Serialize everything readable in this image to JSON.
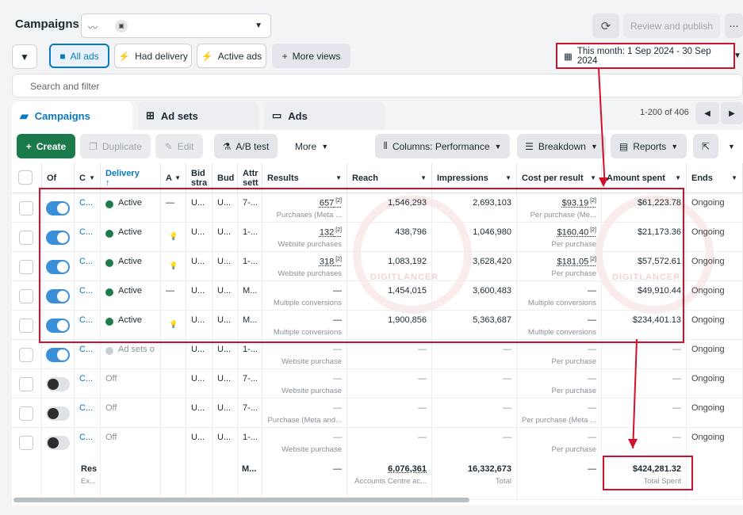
{
  "header": {
    "title": "Campaigns",
    "refresh_icon": "refresh-icon",
    "review_label": "Review and publish",
    "more_icon": "more-icon"
  },
  "filters": {
    "all_ads": "All ads",
    "had_delivery": "Had delivery",
    "active_ads": "Active ads",
    "more_views": "More views",
    "date_range": "This month: 1 Sep 2024 - 30 Sep 2024"
  },
  "search": {
    "placeholder": "Search and filter"
  },
  "tabs": [
    {
      "label": "Campaigns"
    },
    {
      "label": "Ad sets"
    },
    {
      "label": "Ads"
    }
  ],
  "pager": {
    "range": "1-200 of 406"
  },
  "toolbar": {
    "create": "Create",
    "duplicate": "Duplicate",
    "edit": "Edit",
    "ab_test": "A/B test",
    "more": "More",
    "columns": "Columns: Performance",
    "breakdown": "Breakdown",
    "reports": "Reports"
  },
  "columns": {
    "off": "Of",
    "name": "C",
    "delivery": "Delivery",
    "delivery_arrow": "↑",
    "a": "A",
    "bid_1": "Bid",
    "bid_2": "stra",
    "budget": "Bud",
    "attr_1": "Attr",
    "attr_2": "sett",
    "results": "Results",
    "reach": "Reach",
    "impressions": "Impressions",
    "cpr": "Cost per result",
    "spent": "Amount spent",
    "ends": "Ends"
  },
  "rows": [
    {
      "toggle": "on",
      "name": "C...",
      "status": "Active",
      "a": "—",
      "bid": "U...",
      "bud": "U...",
      "attr": "7-...",
      "results": "657",
      "results_sub": "Purchases (Meta ...",
      "reach": "1,546,293",
      "impressions": "2,693,103",
      "cpr": "$93.19",
      "cpr_sub": "Per purchase (Me...",
      "spent": "$61,223.78",
      "ends": "Ongoing"
    },
    {
      "toggle": "on",
      "name": "C...",
      "status": "Active",
      "a": "💡",
      "bid": "U...",
      "bud": "U...",
      "attr": "1-...",
      "results": "132",
      "results_sub": "Website purchases",
      "reach": "438,796",
      "impressions": "1,046,980",
      "cpr": "$160.40",
      "cpr_sub": "Per purchase",
      "spent": "$21,173.36",
      "ends": "Ongoing"
    },
    {
      "toggle": "on",
      "name": "C...",
      "status": "Active",
      "a": "💡",
      "bid": "U...",
      "bud": "U...",
      "attr": "1-...",
      "results": "318",
      "results_sub": "Website purchases",
      "reach": "1,083,192",
      "impressions": "3,628,420",
      "cpr": "$181.05",
      "cpr_sub": "Per purchase",
      "spent": "$57,572.61",
      "ends": "Ongoing"
    },
    {
      "toggle": "on",
      "name": "C...",
      "status": "Active",
      "a": "—",
      "bid": "U...",
      "bud": "U...",
      "attr": "M...",
      "results": "—",
      "results_sub": "Multiple conversions",
      "reach": "1,454,015",
      "impressions": "3,600,483",
      "cpr": "—",
      "cpr_sub": "Multiple conversions",
      "spent": "$49,910.44",
      "ends": "Ongoing"
    },
    {
      "toggle": "on",
      "name": "C...",
      "status": "Active",
      "a": "💡",
      "bid": "U...",
      "bud": "U...",
      "attr": "M...",
      "results": "—",
      "results_sub": "Multiple conversions",
      "reach": "1,900,856",
      "impressions": "5,363,687",
      "cpr": "—",
      "cpr_sub": "Multiple conversions",
      "spent": "$234,401.13",
      "ends": "Ongoing"
    },
    {
      "toggle": "on",
      "name": "C...",
      "status": "Ad sets o",
      "a": "",
      "bid": "U...",
      "bud": "U...",
      "attr": "1-...",
      "results": "—",
      "results_sub": "Website purchase",
      "reach": "—",
      "impressions": "—",
      "cpr": "—",
      "cpr_sub": "Per purchase",
      "spent": "—",
      "ends": "Ongoing"
    },
    {
      "toggle": "off",
      "name": "C...",
      "status": "Off",
      "a": "",
      "bid": "U...",
      "bud": "U...",
      "attr": "7-...",
      "results": "—",
      "results_sub": "Website purchase",
      "reach": "—",
      "impressions": "—",
      "cpr": "—",
      "cpr_sub": "Per purchase",
      "spent": "—",
      "ends": "Ongoing"
    },
    {
      "toggle": "off",
      "name": "C...",
      "status": "Off",
      "a": "",
      "bid": "U...",
      "bud": "U...",
      "attr": "7-...",
      "results": "—",
      "results_sub": "Purchase (Meta and...",
      "reach": "—",
      "impressions": "—",
      "cpr": "—",
      "cpr_sub": "Per purchase (Meta ...",
      "spent": "—",
      "ends": "Ongoing"
    },
    {
      "toggle": "off",
      "name": "C...",
      "status": "Off",
      "a": "",
      "bid": "U...",
      "bud": "U...",
      "attr": "1-...",
      "results": "—",
      "results_sub": "Website purchase",
      "reach": "—",
      "impressions": "—",
      "cpr": "—",
      "cpr_sub": "Per purchase",
      "spent": "—",
      "ends": "Ongoing"
    }
  ],
  "totals": {
    "label": "Res",
    "label_sub": "Ex...",
    "attr": "M...",
    "results": "—",
    "reach": "6,076,361",
    "reach_sub": "Accounts Centre ac...",
    "impressions": "16,332,673",
    "impressions_sub": "Total",
    "cpr": "—",
    "spent": "$424,281.32",
    "spent_sub": "Total Spent"
  },
  "watermark": "DIGITLANCER",
  "colors": {
    "accent": "#0a78be",
    "annotation_red": "#d0112b",
    "create_green": "#1a7a4c"
  }
}
